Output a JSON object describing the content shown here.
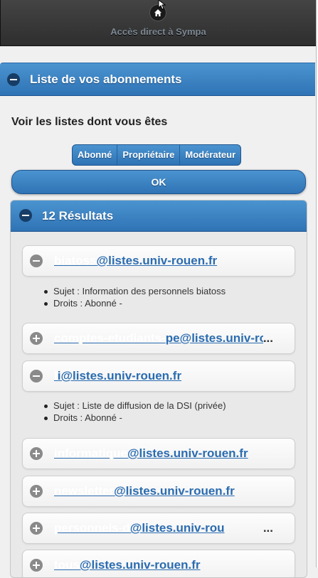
{
  "topbar": {
    "title": "Accès direct à Sympa",
    "home_icon": "home-icon"
  },
  "section": {
    "title": "Liste de vos abonnements"
  },
  "filter": {
    "label": "Voir les listes dont vous êtes",
    "options": [
      "Abonné",
      "Propriétaire",
      "Modérateur"
    ]
  },
  "ok_label": "OK",
  "results": {
    "title": "12 Résultats",
    "items": [
      {
        "masked": "biatoss",
        "address": "@listes.univ-rouen.fr",
        "expanded": true,
        "subject": "Sujet : Information des personnels biatoss",
        "rights": "Droits : Abonné -"
      },
      {
        "masked": "comptes-etudiants-",
        "address": "pe@listes.univ-ro",
        "expanded": false,
        "ellipsis": "..."
      },
      {
        "masked": "l",
        "address": "i@listes.univ-rouen.fr",
        "expanded": true,
        "subject": "Sujet : Liste de diffusion de la DSI (privée)",
        "rights": "Droits : Abonné -"
      },
      {
        "masked": "informatique",
        "address": "@listes.univ-rouen.fr",
        "expanded": false
      },
      {
        "masked": "newsletter",
        "address": "@listes.univ-rouen.fr",
        "expanded": false
      },
      {
        "masked": "personnels-d",
        "address": "@listes.univ-rou",
        "expanded": false,
        "ellipsis": "..."
      },
      {
        "masked": "tous",
        "address": "@listes.univ-rouen.fr",
        "expanded": false
      }
    ]
  },
  "colors": {
    "accent": "#2f73b5",
    "link": "#2b6cb0",
    "topbar": "#333333"
  }
}
